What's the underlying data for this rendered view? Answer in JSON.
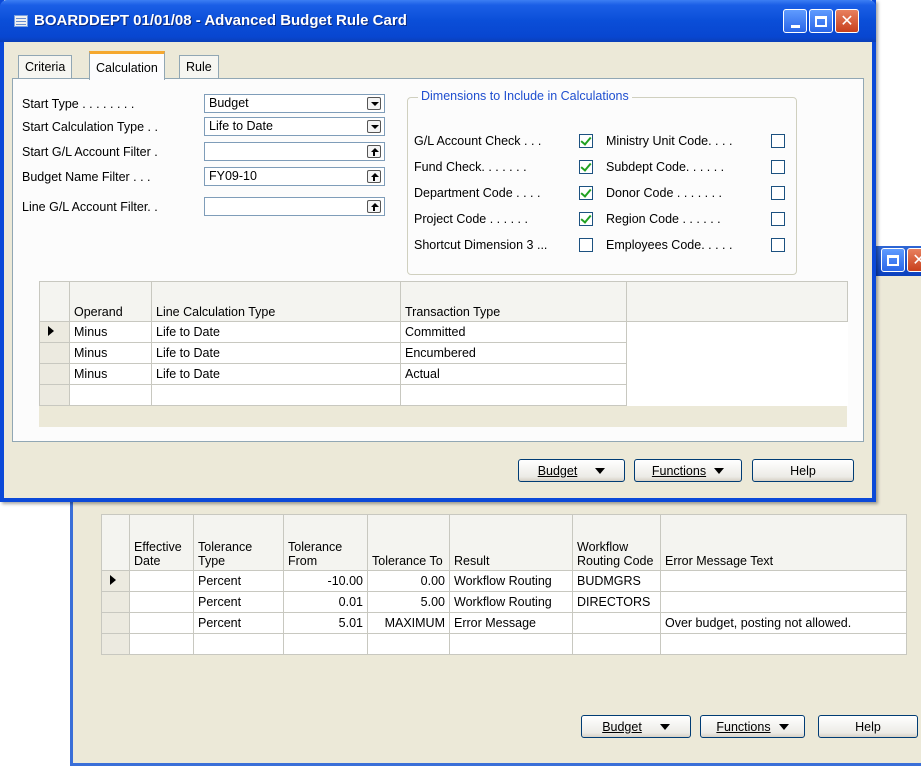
{
  "window": {
    "title": "BOARDDEPT 01/01/08 - Advanced Budget Rule Card"
  },
  "tabs": [
    {
      "label": "Criteria",
      "active": false
    },
    {
      "label": "Calculation",
      "active": true
    },
    {
      "label": "Rule",
      "active": false
    }
  ],
  "fields": {
    "start_type": {
      "label": "Start Type . . . . . . . .",
      "value": "Budget"
    },
    "start_calc_type": {
      "label": "Start Calculation Type . .",
      "value": "Life to Date"
    },
    "start_gl_filter": {
      "label": "Start G/L Account Filter .",
      "value": ""
    },
    "budget_name_filter": {
      "label": "Budget Name Filter . . .",
      "value": "FY09-10"
    },
    "line_gl_filter": {
      "label": "Line G/L Account Filter. .",
      "value": ""
    }
  },
  "dimensions": {
    "title": "Dimensions to Include in Calculations",
    "left": [
      {
        "label": "G/L Account Check . . .",
        "checked": true
      },
      {
        "label": "Fund Check. . . . . . .",
        "checked": true
      },
      {
        "label": "Department Code . . . .",
        "checked": true
      },
      {
        "label": "Project Code . . . . . .",
        "checked": true
      },
      {
        "label": "Shortcut Dimension 3 ...",
        "checked": false
      }
    ],
    "right": [
      {
        "label": "Ministry Unit Code. . . .",
        "checked": false
      },
      {
        "label": "Subdept Code. . . . . .",
        "checked": false
      },
      {
        "label": "Donor Code . . . . . . .",
        "checked": false
      },
      {
        "label": "Region Code . . . . . .",
        "checked": false
      },
      {
        "label": "Employees Code. . . . .",
        "checked": false
      }
    ]
  },
  "calc_grid": {
    "headers": [
      "Operand",
      "Line Calculation Type",
      "Transaction Type"
    ],
    "rows": [
      [
        "Minus",
        "Life to Date",
        "Committed"
      ],
      [
        "Minus",
        "Life to Date",
        "Encumbered"
      ],
      [
        "Minus",
        "Life to Date",
        "Actual"
      ]
    ]
  },
  "rule_grid": {
    "headers": [
      "Effective Date",
      "Tolerance Type",
      "Tolerance From",
      "Tolerance To",
      "Result",
      "Workflow Routing Code",
      "Error Message Text"
    ],
    "rows": [
      [
        "",
        "Percent",
        "-10.00",
        "0.00",
        "Workflow Routing",
        "BUDMGRS",
        ""
      ],
      [
        "",
        "Percent",
        "0.01",
        "5.00",
        "Workflow Routing",
        "DIRECTORS",
        ""
      ],
      [
        "",
        "Percent",
        "5.01",
        "MAXIMUM",
        "Error Message",
        "",
        "Over budget, posting not allowed."
      ]
    ]
  },
  "buttons": {
    "budget": "Budget",
    "functions": "Functions",
    "help": "Help"
  },
  "colors": {
    "titlebar": "#0a4ed8",
    "window_bg": "#ece9d8",
    "group_title": "#1f4fd0",
    "tab_accent": "#f5a830",
    "check": "#21a121"
  }
}
